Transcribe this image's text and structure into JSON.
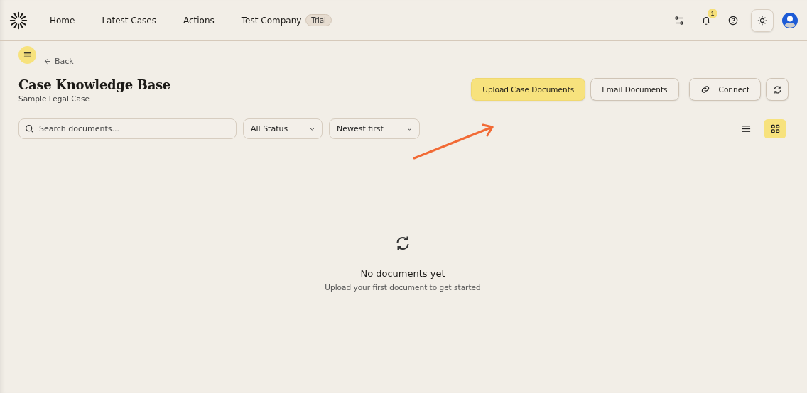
{
  "nav": {
    "items": [
      {
        "label": "Home"
      },
      {
        "label": "Latest Cases"
      },
      {
        "label": "Actions"
      },
      {
        "label": "Test Company"
      }
    ],
    "plan_badge": "Trial"
  },
  "notifications": {
    "count": "1"
  },
  "back": "Back",
  "header": {
    "title": "Case Knowledge Base",
    "subtitle": "Sample Legal Case"
  },
  "actions": [
    {
      "label": "Upload Case Documents",
      "kind": "primary"
    },
    {
      "label": "Email Documents",
      "kind": "secondary"
    },
    {
      "label": "Connect",
      "kind": "link"
    },
    {
      "kind": "refresh"
    }
  ],
  "search": {
    "placeholder": "Search documents..."
  },
  "filters": [
    {
      "value": "All Status"
    },
    {
      "value": "Newest first"
    }
  ],
  "views": [
    {
      "kind": "list",
      "selected": false
    },
    {
      "kind": "grid",
      "selected": true
    }
  ],
  "empty": {
    "title": "No documents yet",
    "text": "Upload your first document to get started"
  }
}
